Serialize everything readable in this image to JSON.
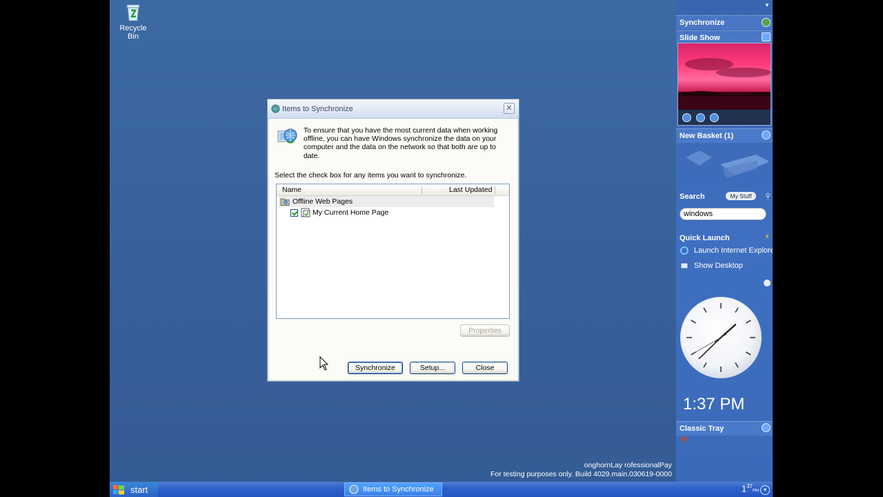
{
  "desktop": {
    "recycle_bin_label": "Recycle Bin",
    "watermark_line1": "onghornLay rofessionalPay",
    "watermark_line2": "For testing purposes only. Build 4029.main.030619-0000"
  },
  "taskbar": {
    "start_label": "start",
    "task_button_label": "Items to Synchronize",
    "clock_hour": "1",
    "clock_minutes": "37",
    "clock_ampm": "PM"
  },
  "sidebar": {
    "synchronize_label": "Synchronize",
    "slideshow_label": "Slide Show",
    "basket_label": "New Basket (1)",
    "search_label": "Search",
    "my_stuff_label": "My Stuff",
    "search_value": "windows",
    "quick_launch_label": "Quick Launch",
    "quick_launch_items": [
      "Launch Internet Explorer",
      "Show Desktop"
    ],
    "digital_time": "1:37 PM",
    "classic_tray_label": "Classic Tray",
    "clock_time": {
      "hour": 1,
      "minute": 37,
      "second": 40
    }
  },
  "dialog": {
    "title": "Items to Synchronize",
    "intro_text": "To ensure that you have the most current data when working offline, you can have Windows synchronize the data on your computer and the data on the network so that both are up to date.",
    "instruction": "Select the check box for any items you want to synchronize.",
    "columns": [
      "Name",
      "Last Updated"
    ],
    "rows": [
      {
        "name": "Offline Web Pages",
        "checked": null,
        "selected": true
      },
      {
        "name": "My Current Home Page",
        "checked": true,
        "selected": false
      }
    ],
    "properties_label": "Properties",
    "synchronize_label": "Synchronize",
    "setup_label": "Setup...",
    "close_label": "Close"
  },
  "colors": {
    "desktop_blue": "#3a6ea5",
    "taskbar_blue": "#2456c2",
    "sidebar_blue": "#3f6fc0",
    "dialog_bg": "#ece9d8"
  }
}
